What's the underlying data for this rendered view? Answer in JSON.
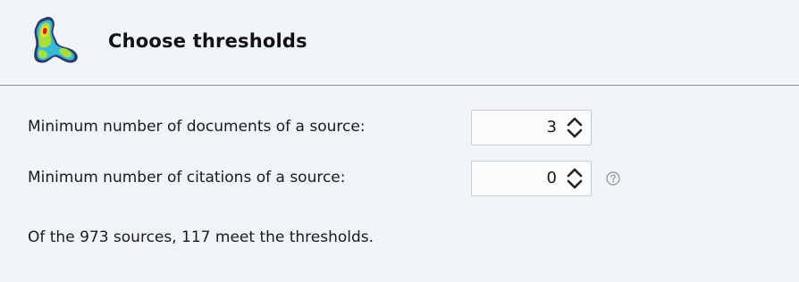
{
  "header": {
    "title": "Choose thresholds",
    "logo_icon": "heatmap-logo-icon"
  },
  "thresholds": {
    "min_documents": {
      "label": "Minimum number of documents of a source:",
      "value": "3"
    },
    "min_citations": {
      "label": "Minimum number of citations of a source:",
      "value": "0",
      "help_icon": "help-icon"
    }
  },
  "status": {
    "text": "Of the 973 sources, 117 meet the thresholds."
  },
  "colors": {
    "background": "#f1f4f8",
    "divider": "#8e8e8e",
    "input_border": "#c7ccd3"
  }
}
